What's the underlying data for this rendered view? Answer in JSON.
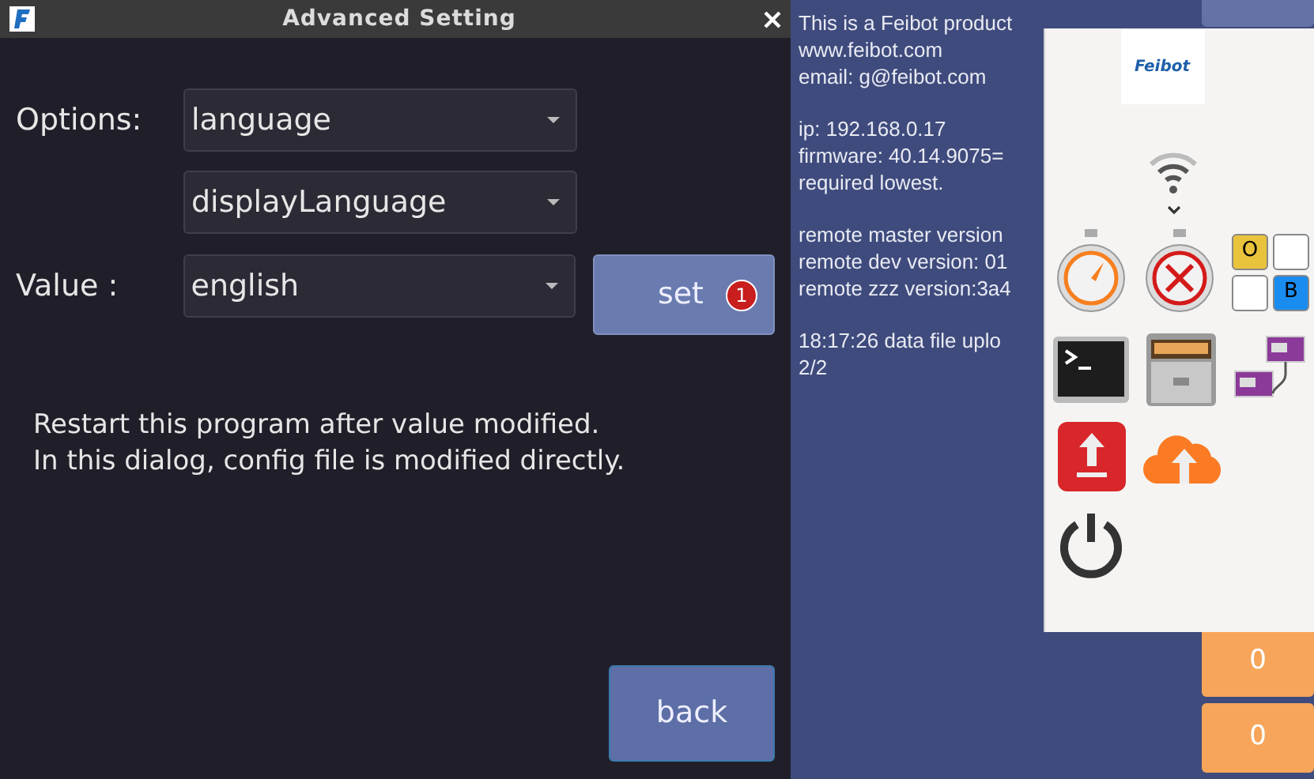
{
  "dialog": {
    "title": "Advanced Setting",
    "options_label": "Options:",
    "option_dropdowns": [
      "language",
      "displayLanguage"
    ],
    "value_label": "Value :",
    "value_dropdown": "english",
    "set_button": {
      "label": "set",
      "badge": "1"
    },
    "notes": [
      "Restart this program after value modified.",
      "In this dialog, config file is modified directly."
    ],
    "back_button": "back"
  },
  "info_paragraphs": [
    [
      "This is a Feibot product",
      "www.feibot.com",
      "email: g@feibot.com"
    ],
    [
      "ip: 192.168.0.17",
      "firmware: 40.14.9075=",
      "required lowest."
    ],
    [
      "remote master version",
      "remote dev version: 01",
      "remote zzz version:3a4"
    ],
    [
      "18:17:26 data file uplo",
      "2/2"
    ]
  ],
  "launcher": {
    "logo": "Feibot",
    "tiles": [
      {
        "label": "O",
        "color": "#e9c33c"
      },
      {
        "color": "#ffffff"
      },
      {
        "color": "#ffffff"
      },
      {
        "label": "B",
        "color": "#1a8cf0"
      }
    ]
  },
  "counters": [
    "0",
    "0"
  ]
}
